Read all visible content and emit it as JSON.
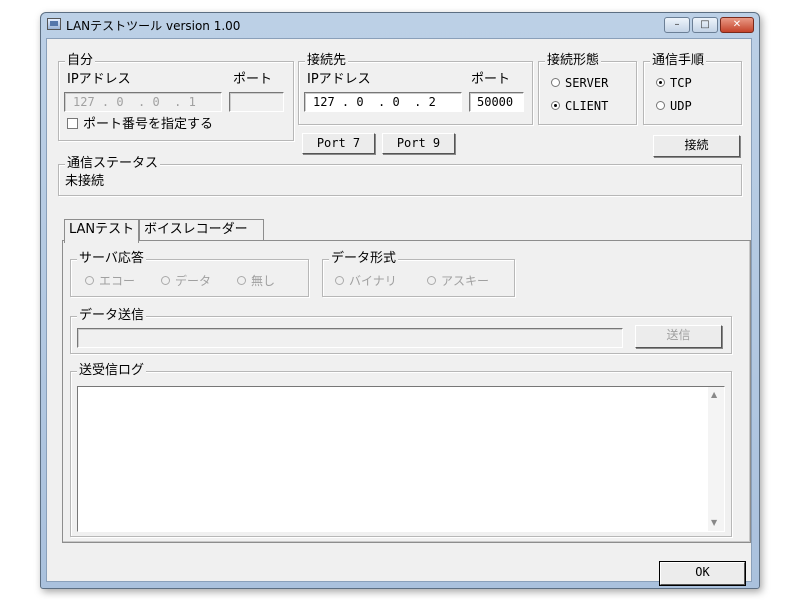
{
  "window": {
    "title": "LANテストツール version 1.00",
    "minimize_glyph": "–",
    "maximize_glyph": "□",
    "close_glyph": "✕"
  },
  "self": {
    "group_title": "自分",
    "ip_label": "IPアドレス",
    "port_label": "ポート",
    "ip_value": "127 . 0  . 0  . 1",
    "port_value": "",
    "specify_port_label": "ポート番号を指定する",
    "specify_port_checked": false
  },
  "dest": {
    "group_title": "接続先",
    "ip_label": "IPアドレス",
    "port_label": "ポート",
    "ip_value": "127 . 0  . 0  . 2",
    "port_value": "50000",
    "port7_button": "Port 7",
    "port9_button": "Port 9"
  },
  "conn_type": {
    "group_title": "接続形態",
    "options": [
      "SERVER",
      "CLIENT"
    ],
    "selected": "CLIENT"
  },
  "protocol": {
    "group_title": "通信手順",
    "options": [
      "TCP",
      "UDP"
    ],
    "selected": "TCP"
  },
  "connect_button": "接続",
  "status": {
    "group_title": "通信ステータス",
    "text": "未接続"
  },
  "tabs": [
    {
      "label": "LANテスト",
      "active": true
    },
    {
      "label": "ボイスレコーダー",
      "active": false
    }
  ],
  "server_response": {
    "group_title": "サーバ応答",
    "options": [
      "エコー",
      "データ",
      "無し"
    ]
  },
  "data_format": {
    "group_title": "データ形式",
    "options": [
      "バイナリ",
      "アスキー"
    ]
  },
  "send": {
    "group_title": "データ送信",
    "input_value": "",
    "button_label": "送信"
  },
  "log": {
    "group_title": "送受信ログ",
    "content": "",
    "scroll_up": "▲",
    "scroll_down": "▼"
  },
  "ok_button": "OK",
  "icons": [
    "app-icon",
    "minimize-icon",
    "maximize-icon",
    "close-icon"
  ]
}
